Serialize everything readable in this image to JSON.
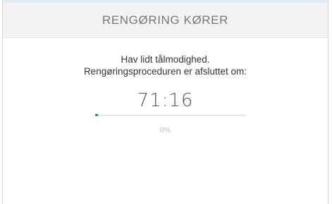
{
  "header": {
    "title": "RENGØRING KØRER"
  },
  "message": {
    "line1": "Hav lidt tålmodighed.",
    "line2": "Rengøringsproceduren er afsluttet om:"
  },
  "timer": {
    "remaining": "71:16"
  },
  "progress": {
    "percent_label": "0%",
    "fraction": 0.02,
    "color": "#1f76d2",
    "track_color": "#e6e6e6"
  }
}
